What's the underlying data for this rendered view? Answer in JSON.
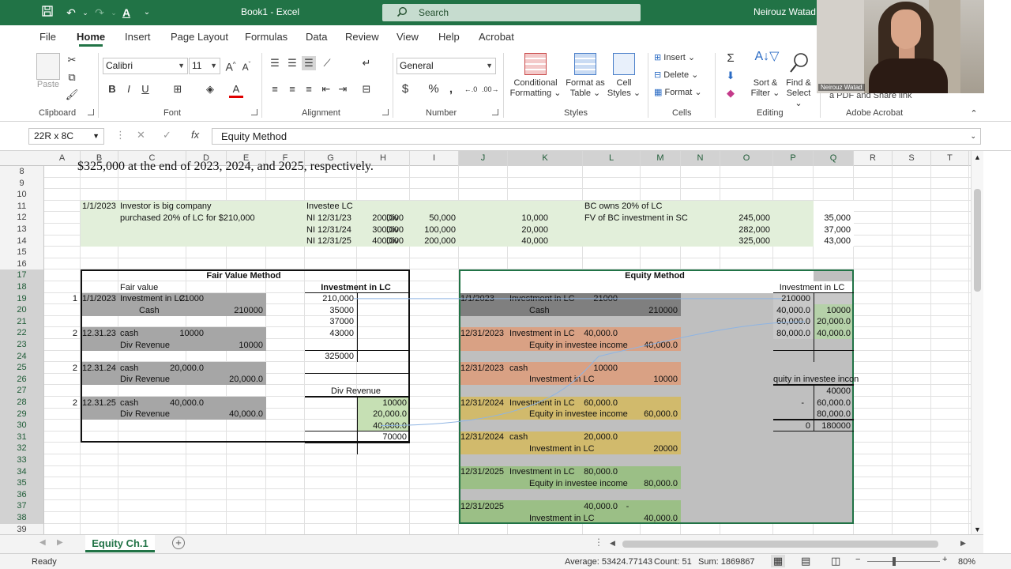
{
  "titlebar": {
    "doc_title": "Book1  -  Excel",
    "search_placeholder": "Search",
    "user_name": "Neirouz Watad",
    "webcam_label": "Neirouz Watad",
    "accent": "#217346"
  },
  "menu": {
    "tabs": [
      "File",
      "Home",
      "Insert",
      "Page Layout",
      "Formulas",
      "Data",
      "Review",
      "View",
      "Help",
      "Acrobat"
    ]
  },
  "ribbon": {
    "clipboard": {
      "paste": "Paste",
      "label": "Clipboard"
    },
    "font": {
      "name": "Calibri",
      "size": "11",
      "label": "Font"
    },
    "alignment": {
      "label": "Alignment"
    },
    "number": {
      "format": "General",
      "label": "Number"
    },
    "styles": {
      "conditional": "Conditional",
      "conditional2": "Formatting",
      "format_as": "Format as",
      "format_as2": "Table",
      "cell": "Cell",
      "cell2": "Styles",
      "label": "Styles"
    },
    "cells": {
      "insert": "Insert",
      "delete": "Delete",
      "format": "Format",
      "label": "Cells"
    },
    "editing": {
      "sort": "Sort &",
      "sort2": "Filter",
      "find": "Find &",
      "find2": "Select",
      "label": "Editing"
    },
    "acrobat": {
      "share": "a PDF  and Share link",
      "label": "Adobe Acrobat"
    }
  },
  "formula_bar": {
    "name_box": "22R x 8C",
    "formula": "Equity Method"
  },
  "columns": [
    "A",
    "B",
    "C",
    "D",
    "E",
    "F",
    "G",
    "H",
    "I",
    "J",
    "K",
    "L",
    "M",
    "N",
    "O",
    "P",
    "Q",
    "R",
    "S",
    "T"
  ],
  "rows": [
    "8",
    "9",
    "10",
    "11",
    "12",
    "13",
    "14",
    "15",
    "16",
    "17",
    "18",
    "19",
    "20",
    "21",
    "22",
    "23",
    "24",
    "25",
    "26",
    "27",
    "28",
    "29",
    "30",
    "31",
    "32",
    "33",
    "34",
    "35",
    "36",
    "37",
    "38",
    "39"
  ],
  "sheet": {
    "top_text": "$325,000 at the end of 2023, 2024, and 2025, respectively.",
    "r11": {
      "b": "1/1/2023",
      "c": "Investor is big company",
      "g": "Investee LC",
      "l": "BC owns 20% of LC"
    },
    "r12": {
      "c": "purchased 20% of LC for $210,000",
      "g": "NI 12/31/23",
      "h": "200,000",
      "h2": "Div",
      "j": "50,000",
      "k": "10,000",
      "l": "FV of BC investment in SC",
      "o": "245,000",
      "q": "35,000"
    },
    "r13": {
      "g": "NI 12/31/24",
      "h": "300,000",
      "h2": "Div",
      "j": "100,000",
      "k": "20,000",
      "o": "282,000",
      "q": "37,000"
    },
    "r14": {
      "g": "NI 12/31/25",
      "h": "400,000",
      "h2": "Div",
      "j": "200,000",
      "k": "40,000",
      "o": "325,000",
      "q": "43,000"
    },
    "fv": {
      "title": "Fair Value Method",
      "subtitle": "Fair value",
      "r19": {
        "a": "1",
        "b": "1/1/2023",
        "c": "Investment in LC",
        "d": "21000"
      },
      "r20": {
        "c": "Cash",
        "e": "210000"
      },
      "r22": {
        "a": "2",
        "b": "12.31.23",
        "c": "cash",
        "d": "10000"
      },
      "r23": {
        "c": "Div Revenue",
        "e": "10000"
      },
      "r25": {
        "a": "2",
        "b": "12.31.24",
        "c": "cash",
        "d": "20,000.0"
      },
      "r26": {
        "c": "Div Revenue",
        "e": "20,000.0"
      },
      "r28": {
        "a": "2",
        "b": "12.31.25",
        "c": "cash",
        "d": "40,000.0"
      },
      "r29": {
        "c": "Div Revenue",
        "e": "40,000.0"
      }
    },
    "tacct_inv": {
      "title": "Investment in LC",
      "vals": [
        "210,000",
        "35000",
        "37000",
        "43000"
      ],
      "total": "325000"
    },
    "tacct_div": {
      "title": "Div Revenue",
      "vals": [
        "10000",
        "20,000.0",
        "40,000.0"
      ],
      "total": "70000"
    },
    "eq": {
      "title": "Equity Method",
      "r19": {
        "j": "1/1/2023",
        "k": "Investment in LC",
        "l": "21000"
      },
      "r20": {
        "k": "Cash",
        "m": "210000"
      },
      "r22": {
        "j": "12/31/2023",
        "k": "Investment in LC",
        "l": "40,000.0"
      },
      "r23": {
        "k": "Equity in investee income",
        "m": "40,000.0"
      },
      "r25": {
        "j": "12/31/2023",
        "k": "cash",
        "l": "10000"
      },
      "r26": {
        "k": "Investment in LC",
        "m": "10000"
      },
      "r28": {
        "j": "12/31/2024",
        "k": "Investment in LC",
        "l": "60,000.0"
      },
      "r29": {
        "k": "Equity in investee income",
        "m": "60,000.0"
      },
      "r31": {
        "j": "12/31/2024",
        "k": "cash",
        "l": "20,000.0"
      },
      "r32": {
        "k": "Investment in LC",
        "m": "20000"
      },
      "r34": {
        "j": "12/31/2025",
        "k": "Investment in LC",
        "l": "80,000.0"
      },
      "r35": {
        "k": "Equity in investee income",
        "m": "80,000.0"
      },
      "r37": {
        "j": "12/31/2025",
        "l": "40,000.0",
        "l2": "-"
      },
      "r38": {
        "k": "Investment in LC",
        "m": "40,000.0"
      }
    },
    "eq_tacct_inv": {
      "title": "Investment in LC",
      "p19": "210000",
      "p20": "40,000.0",
      "q20": "10000",
      "p21": "60,000.0",
      "q21": "20,000.0",
      "p22": "80,000.0",
      "q22": "40,000.0"
    },
    "eq_tacct_inc": {
      "title": "quity in investee incon",
      "q27": "40000",
      "p28": "-",
      "q28": "60,000.0",
      "q29": "80,000.0",
      "p30": "0",
      "q30": "180000"
    }
  },
  "sheet_tab": "Equity Ch.1",
  "status": {
    "ready": "Ready",
    "average": "Average: 53424.77143",
    "count": "Count: 51",
    "sum": "Sum: 1869867",
    "zoom": "80%"
  },
  "colors": {
    "green_fill": "#e2efda",
    "gray_fill": "#a6a6a6",
    "orange_fill": "#e8b594",
    "yellow_fill": "#e2cd7e",
    "dkgreen_fill": "#a9d08e",
    "teal_fill": "#c6e0b4"
  }
}
